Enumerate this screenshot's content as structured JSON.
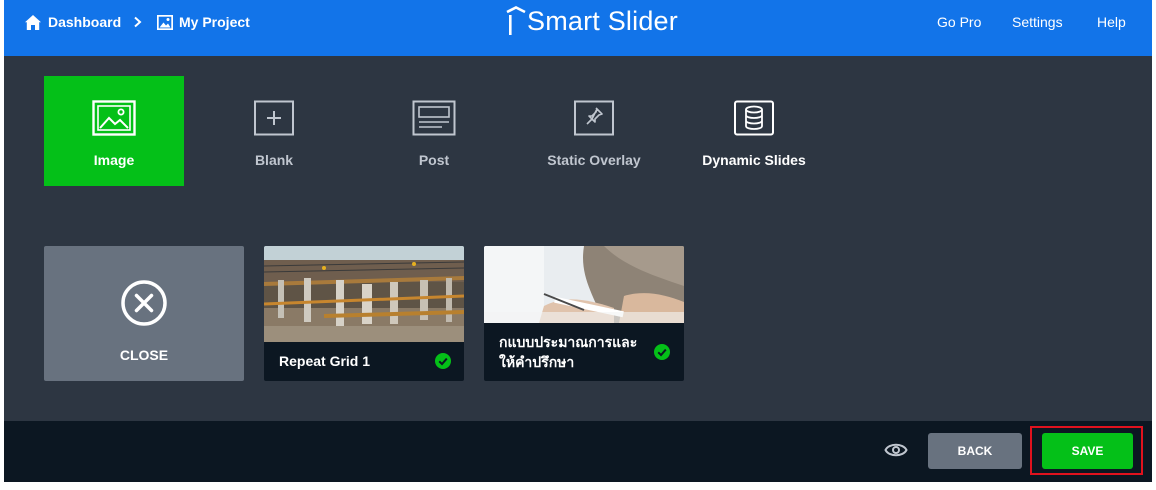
{
  "topbar": {
    "breadcrumb": [
      {
        "label": "Dashboard",
        "icon": "home-icon"
      },
      {
        "label": "My Project",
        "icon": "image-icon"
      }
    ],
    "separator_icon": "chevron-right-icon",
    "logo": "Smart Slider",
    "nav": [
      "Go Pro",
      "Settings",
      "Help"
    ]
  },
  "tabs": [
    {
      "label": "Image",
      "icon": "image-icon",
      "active": true
    },
    {
      "label": "Blank",
      "icon": "plus-box-icon"
    },
    {
      "label": "Post",
      "icon": "post-icon"
    },
    {
      "label": "Static Overlay",
      "icon": "pin-icon"
    },
    {
      "label": "Dynamic Slides",
      "icon": "database-icon"
    }
  ],
  "close_card": {
    "label": "CLOSE",
    "icon": "close-circle-icon"
  },
  "slides": [
    {
      "title": "Repeat Grid 1",
      "status_icon": "check-circle-icon"
    },
    {
      "title": "กแบบประมาณการและให้คำปรึกษา",
      "status_icon": "check-circle-icon"
    }
  ],
  "footer": {
    "preview_icon": "eye-icon",
    "back_label": "BACK",
    "save_label": "SAVE"
  },
  "colors": {
    "topbar": "#1274e9",
    "background": "#2d3642",
    "accent_green": "#04c018",
    "footer": "#0c1722",
    "highlight": "#e0121e"
  }
}
